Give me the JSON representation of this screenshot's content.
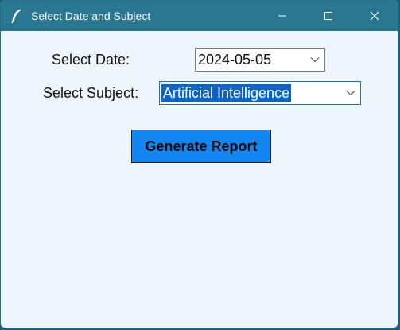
{
  "window": {
    "title": "Select Date and Subject"
  },
  "form": {
    "date_label": "Select Date:",
    "date_value": "2024-05-05",
    "subject_label": "Select Subject:",
    "subject_value": "Artificial Intelligence",
    "generate_button_label": "Generate Report"
  },
  "icons": {
    "app": "feather-icon",
    "minimize": "minimize-icon",
    "maximize": "maximize-icon",
    "close": "close-icon",
    "dropdown": "chevron-down-icon"
  },
  "colors": {
    "titlebar": "#2a7792",
    "window_bg": "#eef6fd",
    "button_bg": "#1386f2",
    "selection": "#0a63c9"
  }
}
